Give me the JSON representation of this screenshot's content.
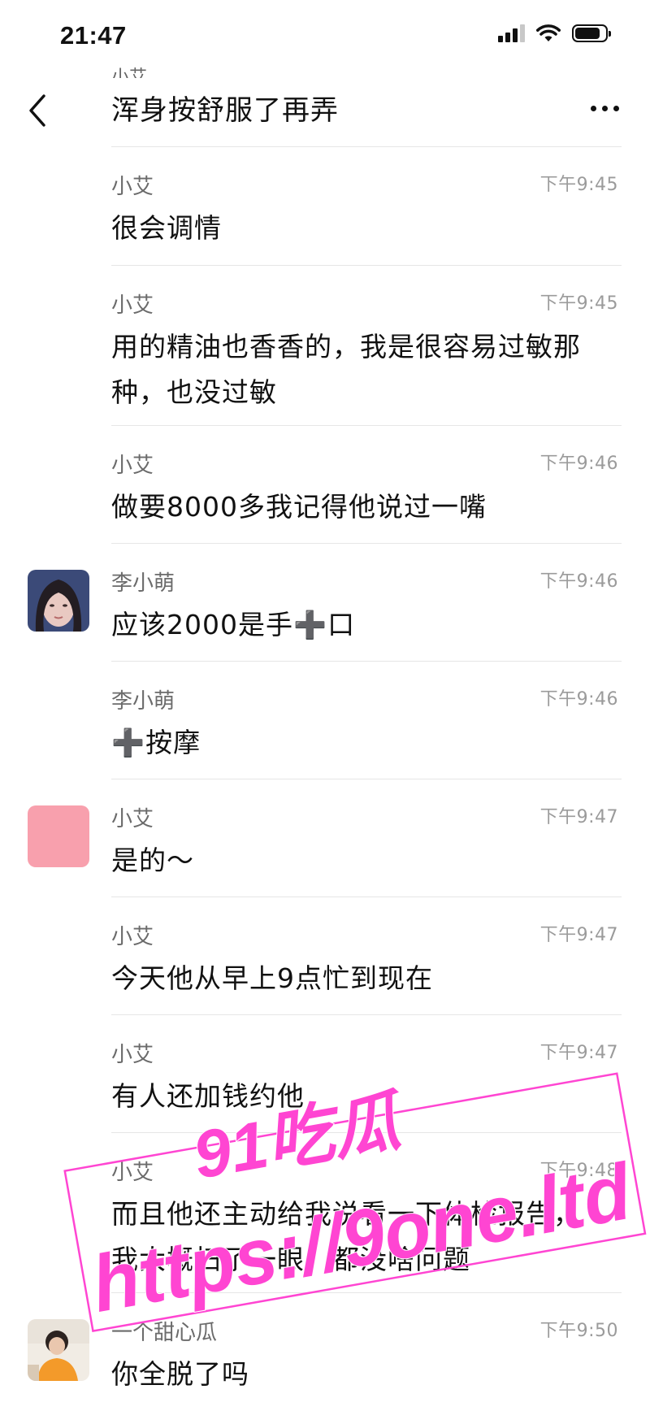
{
  "status_bar": {
    "time": "21:47",
    "icons": [
      "signal-icon",
      "wifi-icon",
      "battery-icon"
    ]
  },
  "nav": {
    "cut_sender": "小艾",
    "title": "浑身按舒服了再弄",
    "back_icon": "chevron-left-icon",
    "more_icon": "more-dots-icon"
  },
  "messages": [
    {
      "sender": "小艾",
      "time": "下午9:45",
      "text": "很会调情"
    },
    {
      "sender": "小艾",
      "time": "下午9:45",
      "text": "用的精油也香香的，我是很容易过敏那种，也没过敏"
    },
    {
      "sender": "小艾",
      "time": "下午9:46",
      "text": "做要8000多我记得他说过一嘴"
    },
    {
      "sender": "李小萌",
      "time": "下午9:46",
      "text": "应该2000是手➕口"
    },
    {
      "sender": "李小萌",
      "time": "下午9:46",
      "text": "➕按摩"
    },
    {
      "sender": "小艾",
      "time": "下午9:47",
      "text": "是的～"
    },
    {
      "sender": "小艾",
      "time": "下午9:47",
      "text": "今天他从早上9点忙到现在"
    },
    {
      "sender": "小艾",
      "time": "下午9:47",
      "text": "有人还加钱约他"
    },
    {
      "sender": "小艾",
      "time": "下午9:48",
      "text": "而且他还主动给我说看一下体检报告，我大概扫了一眼，都没啥问题"
    },
    {
      "sender": "一个甜心瓜",
      "time": "下午9:50",
      "text": "你全脱了吗"
    }
  ],
  "watermark": {
    "line1": "91吃瓜",
    "line2": "https://9one.ltd"
  },
  "colors": {
    "watermark_pink": "#ff45d2",
    "avatar_pink": "#f8a0ad",
    "divider": "#e6e6e6"
  }
}
